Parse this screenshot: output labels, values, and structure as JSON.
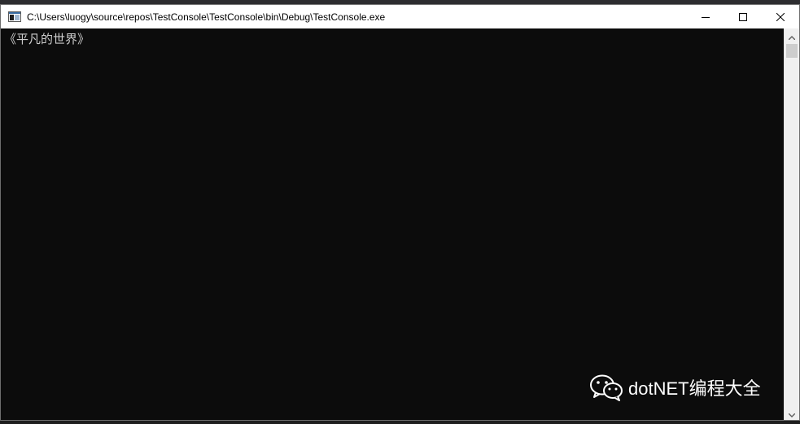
{
  "window": {
    "title": "C:\\Users\\luogy\\source\\repos\\TestConsole\\TestConsole\\bin\\Debug\\TestConsole.exe",
    "icon": "console-app-icon",
    "controls": {
      "minimize": "minimize-icon",
      "maximize": "maximize-icon",
      "close": "close-icon"
    }
  },
  "console": {
    "output_line": "《平凡的世界》",
    "background": "#0c0c0c",
    "foreground": "#cccccc"
  },
  "scrollbar": {
    "up": "chevron-up-icon",
    "down": "chevron-down-icon"
  },
  "watermark": {
    "icon": "wechat-icon",
    "text": "dotNET编程大全"
  }
}
